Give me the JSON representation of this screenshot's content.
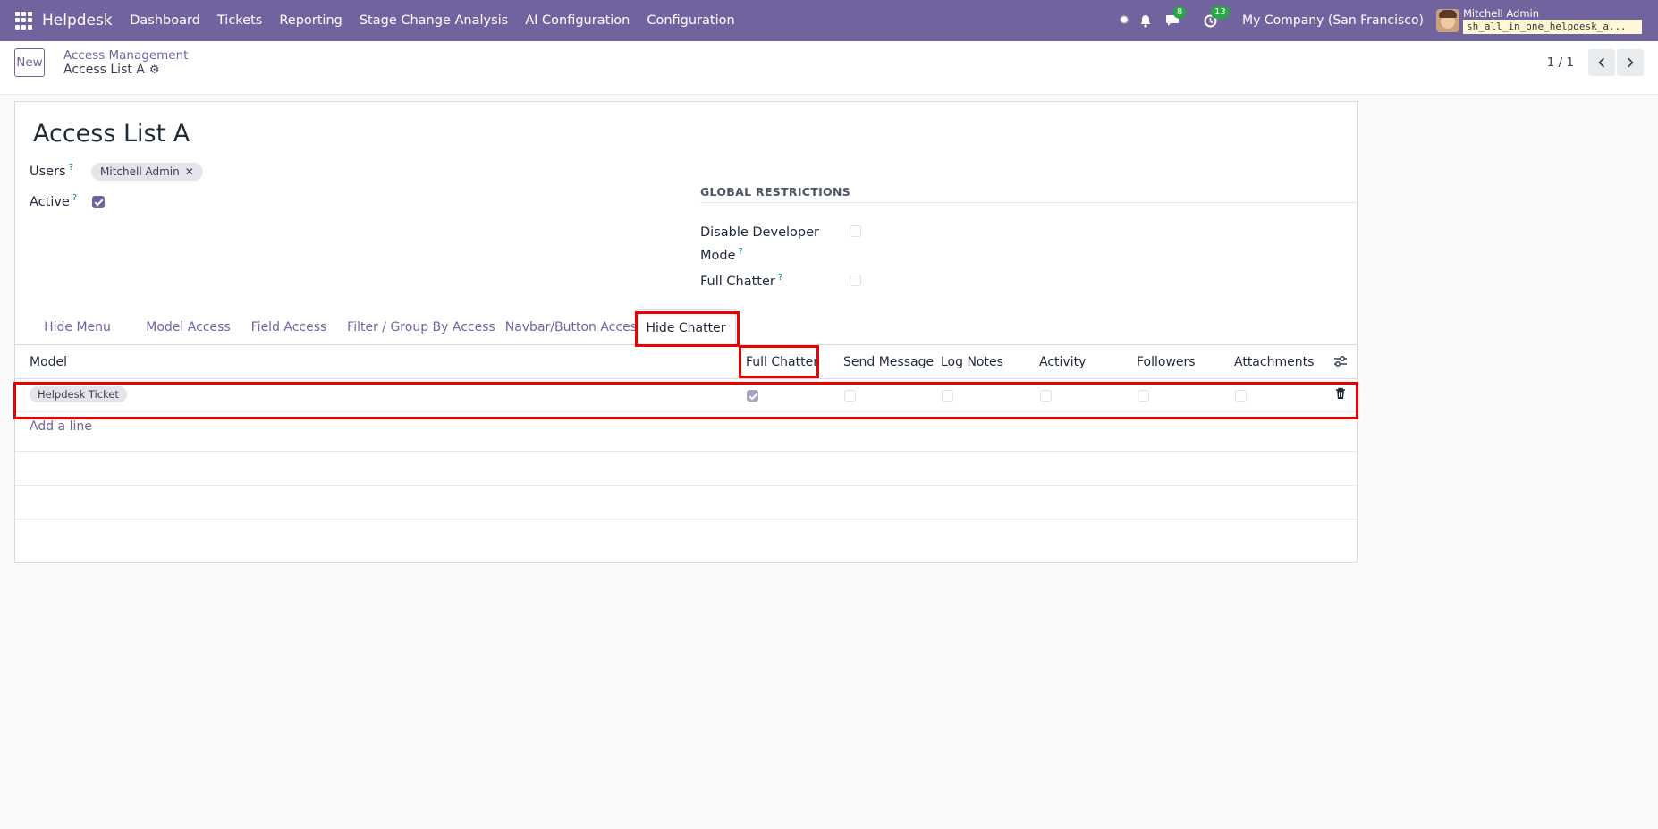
{
  "navbar": {
    "app_name": "Helpdesk",
    "menu": [
      "Dashboard",
      "Tickets",
      "Reporting",
      "Stage Change Analysis",
      "AI Configuration",
      "Configuration"
    ],
    "messages_count": "8",
    "activities_count": "13",
    "company": "My Company (San Francisco)",
    "user_name": "Mitchell Admin",
    "database": "sh_all_in_one_helpdesk_a..."
  },
  "control": {
    "new_label": "New",
    "breadcrumb": "Access Management",
    "record_name": "Access List A",
    "pager": "1 / 1"
  },
  "form": {
    "title": "Access List A",
    "users_label": "Users",
    "users_tags": [
      "Mitchell Admin"
    ],
    "active_label": "Active",
    "active_value": true,
    "global_restrictions_title": "GLOBAL RESTRICTIONS",
    "disable_dev_label_1": "Disable Developer",
    "disable_dev_label_2": "Mode",
    "disable_dev_value": false,
    "full_chatter_label": "Full Chatter",
    "full_chatter_value": false,
    "help_mark": "?"
  },
  "tabs": [
    "Hide Menu",
    "Model Access",
    "Field Access",
    "Filter / Group By Access",
    "Navbar/Button Access",
    "Hide Chatter"
  ],
  "active_tab": "Hide Chatter",
  "table": {
    "columns": [
      "Model",
      "Full Chatter",
      "Send Message",
      "Log Notes",
      "Activity",
      "Followers",
      "Attachments"
    ],
    "rows": [
      {
        "model": "Helpdesk Ticket",
        "full_chatter": true,
        "send_message": false,
        "log_notes": false,
        "activity": false,
        "followers": false,
        "attachments": false
      }
    ],
    "add_line": "Add a line"
  },
  "colors": {
    "primary": "#71639e",
    "highlight": "#ee0000"
  }
}
